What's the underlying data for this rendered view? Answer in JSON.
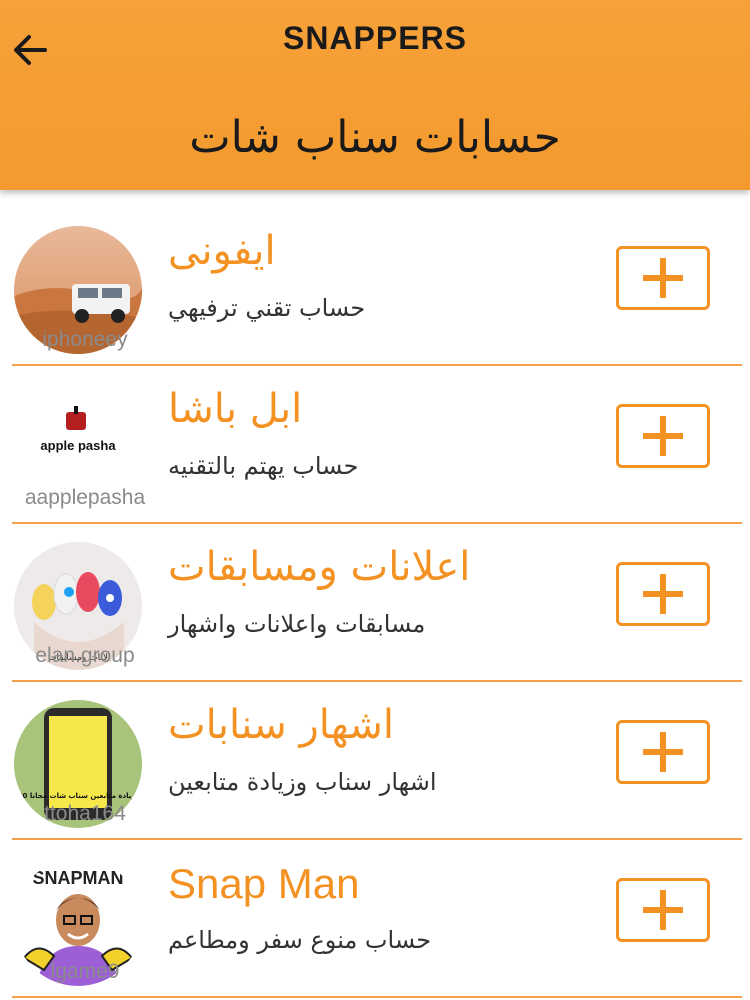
{
  "header": {
    "app_title": "SNAPPERS",
    "page_heading": "حسابات سناب شات",
    "back_icon": "arrow-left-icon"
  },
  "colors": {
    "accent": "#f39222",
    "header_bg": "#f7a13a",
    "handle_text": "#8a8a8a",
    "desc_text": "#333333"
  },
  "accounts": [
    {
      "name": "ايفونى",
      "description": "حساب تقني ترفيهي",
      "handle": "iphoneey",
      "add_icon": "plus-icon"
    },
    {
      "name": "ابل باشا",
      "description": "حساب يهتم بالتقنيه",
      "handle": "aapplepasha",
      "add_icon": "plus-icon",
      "logo_text": "apple pasha"
    },
    {
      "name": "اعلانات ومسابقات",
      "description": "مسابقات واعلانات واشهار",
      "handle": "elan.group",
      "add_icon": "plus-icon",
      "logo_text": "لانات ومسابقات"
    },
    {
      "name": "اشهار سنابات",
      "description": "اشهار سناب وزيادة متابعين",
      "handle": "ttoha164",
      "add_icon": "plus-icon",
      "logo_text": "زيادة متابعين سناب شات مجانا 250 K"
    },
    {
      "name": "Snap Man",
      "description": "حساب منوع سفر ومطاعم",
      "handle": "lgame9",
      "add_icon": "plus-icon",
      "logo_text": "SNAPMAN"
    }
  ]
}
